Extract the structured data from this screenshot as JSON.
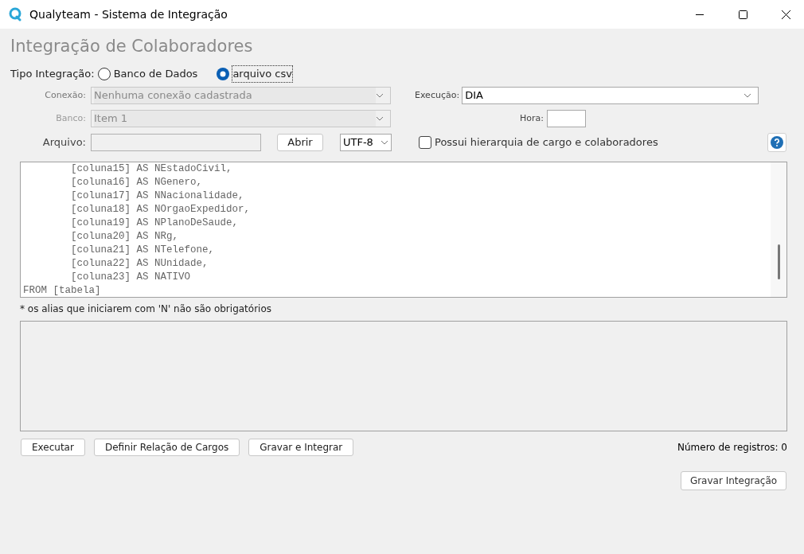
{
  "window": {
    "title": "Qualyteam - Sistema de Integração"
  },
  "heading": "Integração de Colaboradores",
  "tipo": {
    "label": "Tipo Integração:",
    "options": [
      {
        "label": "Banco de Dados",
        "selected": false
      },
      {
        "label": "arquivo csv",
        "selected": true
      }
    ]
  },
  "conexao": {
    "label": "Conexão:",
    "value": "Nenhuma conexão cadastrada",
    "disabled": true
  },
  "banco": {
    "label": "Banco:",
    "value": "Item 1",
    "disabled": true
  },
  "arquivo": {
    "label": "Arquivo:",
    "button": "Abrir",
    "encoding": "UTF-8"
  },
  "execucao": {
    "label": "Execução:",
    "value": "DIA"
  },
  "hora": {
    "label": "Hora:"
  },
  "hierarquia": {
    "label": "Possui hierarquia de cargo e colaboradores",
    "checked": false
  },
  "code_lines": [
    "        [coluna15] AS NEstadoCivil,",
    "        [coluna16] AS NGenero,",
    "        [coluna17] AS NNacionalidade,",
    "        [coluna18] AS NOrgaoExpedidor,",
    "        [coluna19] AS NPlanoDeSaude,",
    "        [coluna20] AS NRg,",
    "        [coluna21] AS NTelefone,",
    "        [coluna22] AS NUnidade,",
    "        [coluna23] AS NATIVO",
    "FROM [tabela]"
  ],
  "note": "* os alias que iniciarem com 'N' não são obrigatórios",
  "actions": [
    "Executar",
    "Definir Relação de Cargos",
    "Gravar e Integrar"
  ],
  "count": "Número de registros: 0",
  "save": "Gravar Integração"
}
